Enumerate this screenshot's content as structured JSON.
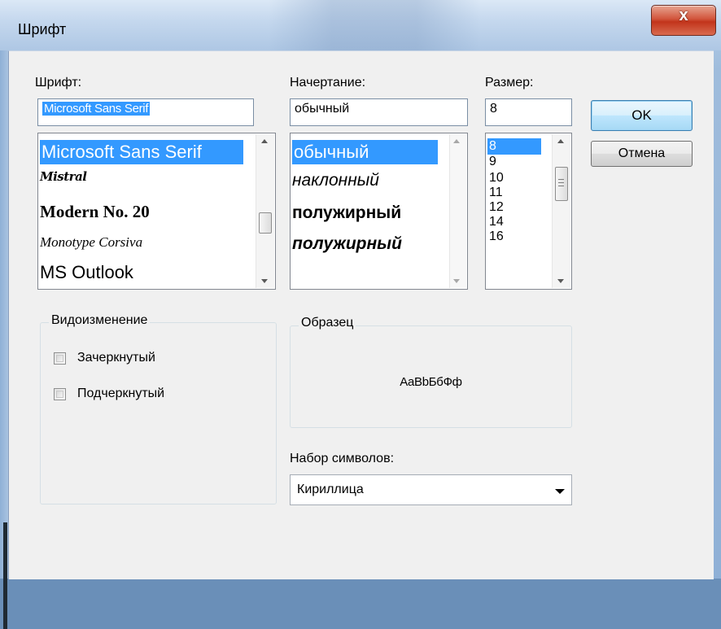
{
  "window": {
    "title": "Шрифт",
    "close_glyph": "x"
  },
  "font": {
    "label": "Шрифт:",
    "value": "Microsoft Sans Serif",
    "items": [
      "Microsoft Sans Serif",
      "Mistral",
      "Modern No. 20",
      "Monotype Corsiva",
      "MS Outlook"
    ]
  },
  "style": {
    "label": "Начертание:",
    "value": "обычный",
    "items": [
      "обычный",
      "наклонный",
      "полужирный",
      "полужирный"
    ]
  },
  "size": {
    "label": "Размер:",
    "value": "8",
    "items": [
      "8",
      "9",
      "10",
      "11",
      "12",
      "14",
      "16"
    ]
  },
  "buttons": {
    "ok": "OK",
    "cancel": "Отмена"
  },
  "effects": {
    "label": "Видоизменение",
    "strikeout": "Зачеркнутый",
    "underline": "Подчеркнутый"
  },
  "sample": {
    "label": "Образец",
    "text": "AaBbБбФф"
  },
  "charset": {
    "label": "Набор символов:",
    "value": "Кириллица"
  }
}
